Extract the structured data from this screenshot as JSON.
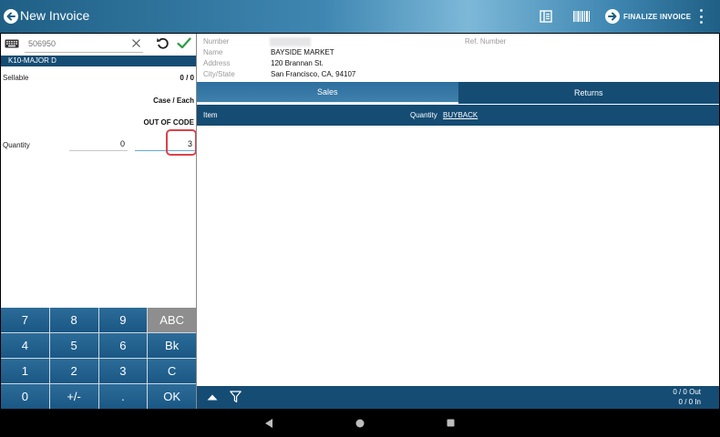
{
  "header": {
    "title": "New Invoice",
    "finalize_label": "FINALIZE INVOICE"
  },
  "left": {
    "search_placeholder": "506950",
    "item_name": "K10-MAJOR D",
    "sellable_label": "Sellable",
    "sellable_value": "0 / 0",
    "case_each_label": "Case / Each",
    "out_of_code_label": "OUT OF CODE",
    "quantity_label": "Quantity",
    "quantity_case": "0",
    "quantity_each": "3"
  },
  "keypad": {
    "keys": [
      "7",
      "8",
      "9",
      "ABC",
      "4",
      "5",
      "6",
      "Bk",
      "1",
      "2",
      "3",
      "C",
      "0",
      "+/-",
      ".",
      "OK"
    ]
  },
  "customer": {
    "number_label": "Number",
    "ref_label": "Ref. Number",
    "name_label": "Name",
    "name_value": "BAYSIDE MARKET",
    "address_label": "Address",
    "address_value": "120 Brannan St.",
    "city_label": "City/State",
    "city_value": "San Francisco, CA, 94107"
  },
  "tabs": {
    "sales": "Sales",
    "returns": "Returns"
  },
  "table": {
    "col_item": "Item",
    "col_quantity": "Quantity",
    "col_buyback": "BUYBACK"
  },
  "footer": {
    "out_count": "0 / 0 Out",
    "in_count": "0 / 0 In"
  },
  "colors": {
    "primary_dark": "#154c73",
    "primary": "#1f5f85",
    "accent_check": "#2a9d44",
    "highlight": "#d9434b"
  },
  "icons": [
    "arrow-left-icon",
    "list-icon",
    "barcode-icon",
    "arrow-right-icon",
    "more-vert-icon",
    "keyboard-icon",
    "close-icon",
    "undo-icon",
    "check-icon",
    "caret-up-icon",
    "filter-icon",
    "nav-back-icon",
    "nav-home-icon",
    "nav-recents-icon"
  ]
}
